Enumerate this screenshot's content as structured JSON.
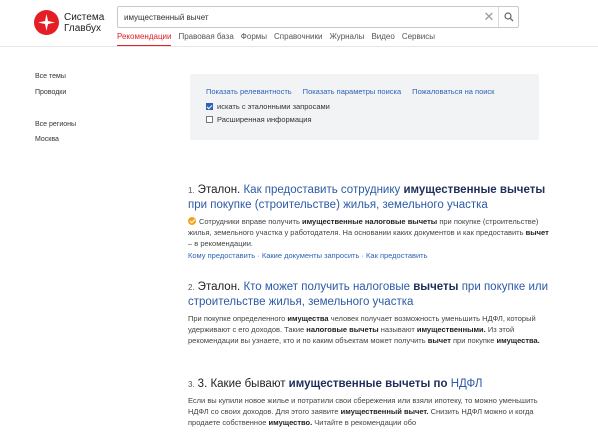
{
  "brand": {
    "line1": "Система",
    "line2": "Главбух"
  },
  "search": {
    "value": "имущественный вычет",
    "clear_icon": "close-icon",
    "submit_icon": "search-icon"
  },
  "nav": [
    {
      "label": "Рекомендации",
      "active": true
    },
    {
      "label": "Правовая база"
    },
    {
      "label": "Формы"
    },
    {
      "label": "Справочники"
    },
    {
      "label": "Журналы"
    },
    {
      "label": "Видео"
    },
    {
      "label": "Сервисы"
    }
  ],
  "sidebar": {
    "topics": [
      "Все темы",
      "Проводки"
    ],
    "regions": [
      "Все регионы",
      "Москва"
    ]
  },
  "panel": {
    "links": [
      "Показать релевантность",
      "Показать параметры поиска",
      "Пожаловаться на поиск"
    ],
    "options": [
      {
        "label": "искать с эталонными запросами",
        "checked": true
      },
      {
        "label": "Расширенная информация",
        "checked": false
      }
    ]
  },
  "results": [
    {
      "number": "1.",
      "prefix": "Эталон.",
      "title_a": "Как предоставить сотруднику",
      "title_b": "имущественные вычеты",
      "title_c": "при покупке (строительстве) жилья, земельного участка",
      "snippet_a": "Сотрудники вправе получить",
      "snippet_b": "имущественные налоговые вычеты",
      "snippet_c": "при покупке (строительстве) жилья, земельного участка у работодателя. На основании каких документов и как предоставить",
      "snippet_d": "вычет",
      "snippet_e": "– в рекомендации.",
      "links": "Кому предоставить · Какие документы запросить · Как предоставить"
    },
    {
      "number": "2.",
      "prefix": "Эталон.",
      "title_a": "Кто может получить налоговые",
      "title_b": "вычеты",
      "title_c": "при покупке или строительстве жилья, земельного участка",
      "snippet_a": "При покупке определенного",
      "snippet_b": "имущества",
      "snippet_c": "человек получает возможность уменьшить НДФЛ, который удерживают с его доходов. Такие",
      "snippet_d": "налоговые вычеты",
      "snippet_e": "называют",
      "snippet_f": "имущественными.",
      "snippet_g": "Из этой рекомендации вы узнаете, кто и по каким объектам может получить",
      "snippet_h": "вычет",
      "snippet_i": "при покупке",
      "snippet_j": "имущества."
    },
    {
      "number": "3.",
      "prefix": "3. Какие бывают",
      "title_b": "имущественные вычеты по",
      "title_c": "НДФЛ",
      "snippet_a": "Если вы купили новое жилье и потратили свои сбережения или взяли ипотеку, то можно уменьшить НДФЛ со своих доходов. Для этого заявите",
      "snippet_b": "имущественный вычет.",
      "snippet_c": "Снизить НДФЛ можно и когда продаете собственное",
      "snippet_d": "имущество.",
      "snippet_e": "Читайте в рекомендации обо"
    }
  ]
}
